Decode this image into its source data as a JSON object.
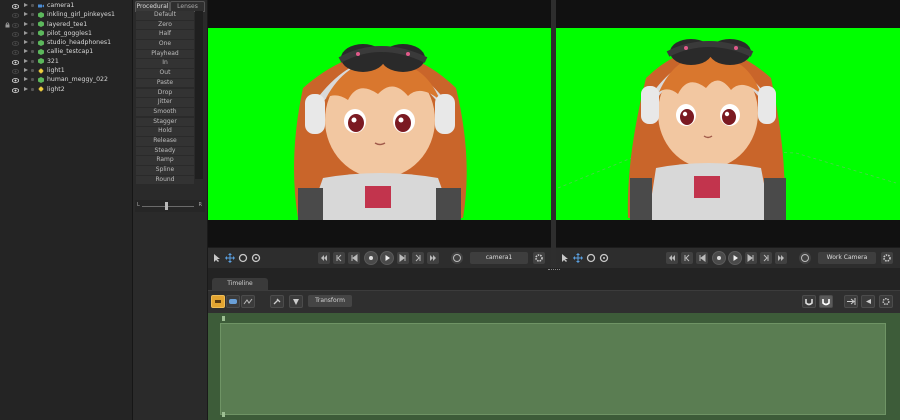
{
  "outliner": {
    "items": [
      {
        "name": "camera1",
        "type": "camera",
        "eye": true,
        "lock": false
      },
      {
        "name": "inkling_girl_pinkeyes1",
        "type": "mesh",
        "eye": false,
        "lock": false
      },
      {
        "name": "layered_tee1",
        "type": "mesh",
        "eye": false,
        "lock": true
      },
      {
        "name": "pilot_goggles1",
        "type": "mesh",
        "eye": false,
        "lock": false
      },
      {
        "name": "studio_headphones1",
        "type": "mesh",
        "eye": false,
        "lock": false
      },
      {
        "name": "callie_testcap1",
        "type": "mesh",
        "eye": false,
        "lock": false
      },
      {
        "name": "321",
        "type": "mesh",
        "eye": true,
        "lock": false
      },
      {
        "name": "light1",
        "type": "light",
        "eye": false,
        "lock": false
      },
      {
        "name": "human_meggy_022",
        "type": "mesh",
        "eye": true,
        "lock": false
      },
      {
        "name": "light2",
        "type": "light",
        "eye": true,
        "lock": false
      }
    ]
  },
  "presets": {
    "tabs": [
      "Procedural",
      "Lenses"
    ],
    "items": [
      "Default",
      "Zero",
      "Half",
      "One",
      "Playhead",
      "In",
      "Out",
      "Paste",
      "Drop",
      "Jitter",
      "Smooth",
      "Stagger",
      "Hold",
      "Release",
      "Steady",
      "Ramp",
      "Spline",
      "Round"
    ],
    "influence": {
      "left": "L",
      "right": "R",
      "value": 0.5
    }
  },
  "viewports": [
    {
      "camera": "camera1",
      "background": "#00ff00"
    },
    {
      "camera": "Work Camera",
      "background": "#00ff00"
    }
  ],
  "timeline": {
    "tab": "Timeline",
    "channel_dropdown": "Transform"
  },
  "colors": {
    "greenscreen": "#00ff00",
    "timeline_body": "#5a7d52",
    "accent_orange": "#e3a531"
  }
}
